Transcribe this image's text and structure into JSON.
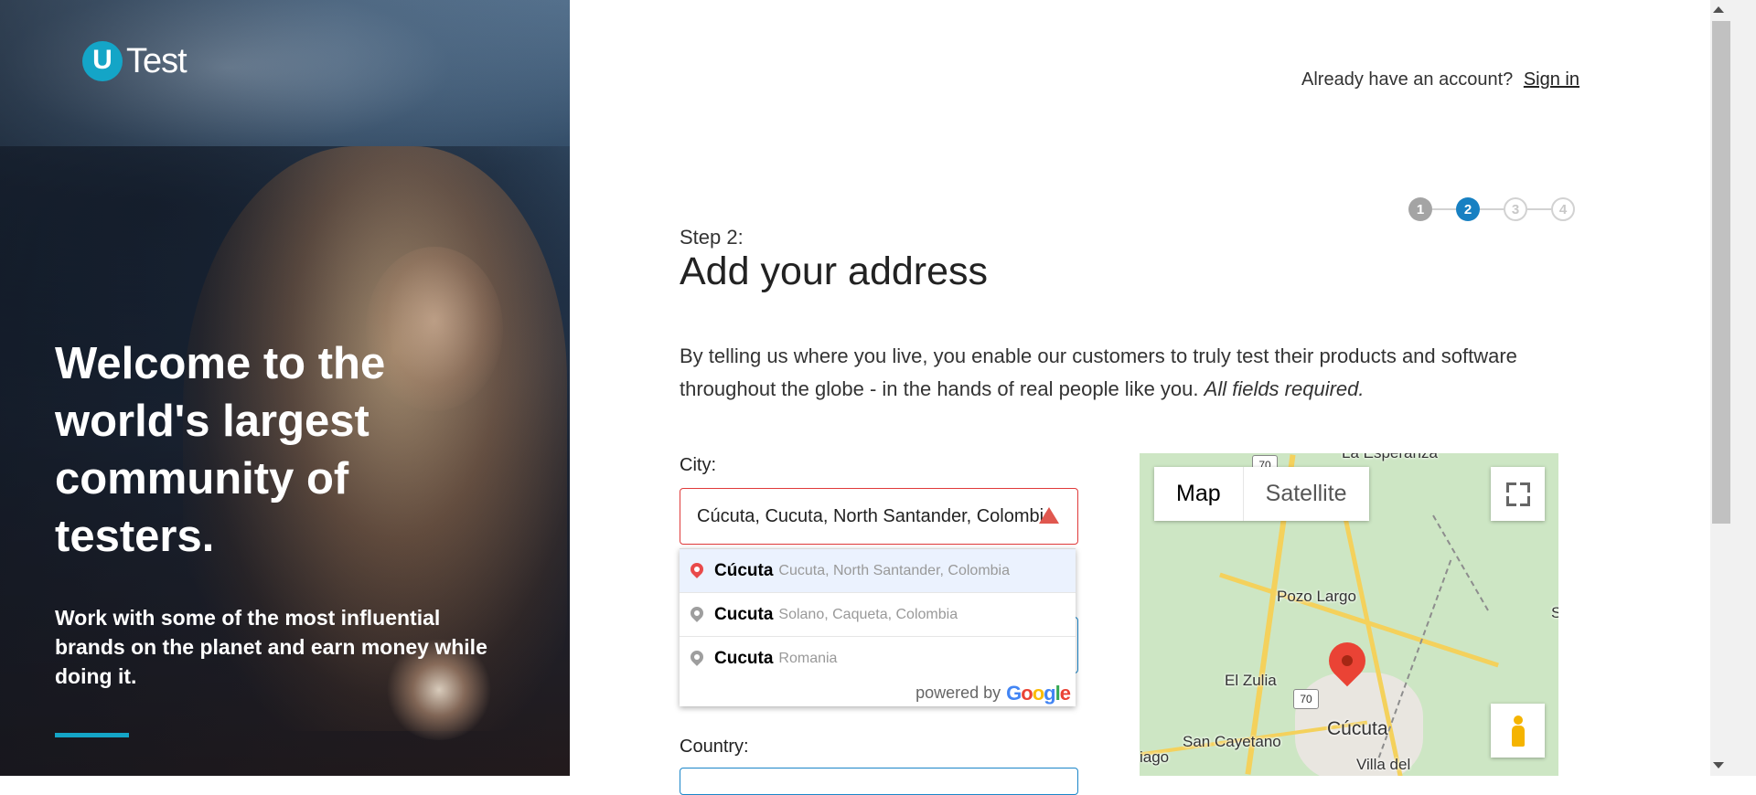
{
  "brand": {
    "logo_mark": "U",
    "logo_word": "Test"
  },
  "hero": {
    "title": "Welcome to the world's largest community of testers.",
    "subtitle": "Work with some of the most influential brands on the planet and earn money while doing it.",
    "accent_color": "#14a5c7"
  },
  "header": {
    "already_text": "Already have an account?",
    "signin_label": "Sign in"
  },
  "stepper": {
    "steps": [
      "1",
      "2",
      "3",
      "4"
    ],
    "current": 2
  },
  "form": {
    "step_label": "Step 2:",
    "title": "Add your address",
    "description": "By telling us where you live, you enable our customers to truly test their products and software throughout the globe - in the hands of real people like you.",
    "required_note": "All fields required.",
    "city_label": "City:",
    "city_value": "Cúcuta, Cucuta, North Santander, Colombia",
    "country_label": "Country:"
  },
  "autocomplete": {
    "items": [
      {
        "main": "Cúcuta",
        "secondary": "Cucuta, North Santander, Colombia"
      },
      {
        "main": "Cucuta",
        "secondary": "Solano, Caqueta, Colombia"
      },
      {
        "main": "Cucuta",
        "secondary": "Romania"
      }
    ],
    "powered_by": "powered by",
    "google_letters": [
      "G",
      "o",
      "o",
      "g",
      "l",
      "e"
    ]
  },
  "map": {
    "tabs": [
      "Map",
      "Satellite"
    ],
    "labels": {
      "pozo_largo": "Pozo Largo",
      "el_zulia": "El Zulia",
      "cucuta": "Cúcuta",
      "san_cayetano": "San Cayetano",
      "la_esperanza": "La Esperanza",
      "villa_del": "Villa del",
      "iago": "iago",
      "s": "S"
    },
    "highway_numbers": [
      "70",
      "70"
    ]
  }
}
